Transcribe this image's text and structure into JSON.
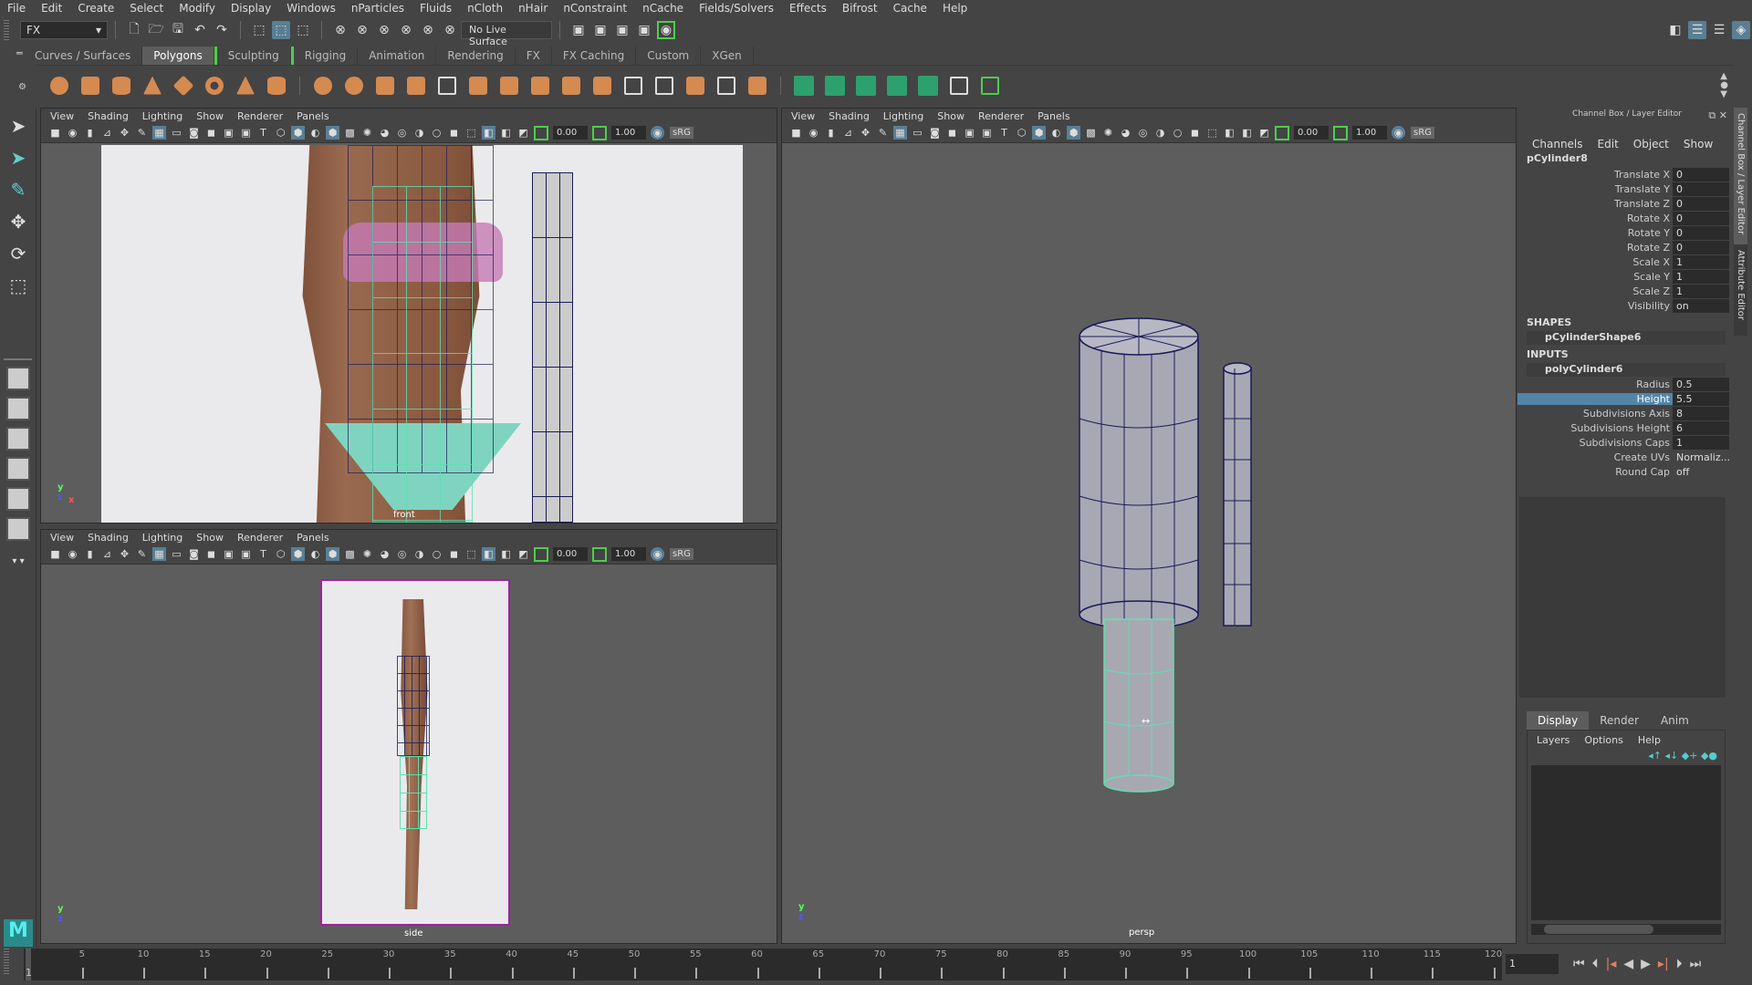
{
  "menubar": [
    "File",
    "Edit",
    "Create",
    "Select",
    "Modify",
    "Display",
    "Windows",
    "nParticles",
    "Fluids",
    "nCloth",
    "nHair",
    "nConstraint",
    "nCache",
    "Fields/Solvers",
    "Effects",
    "Bifrost",
    "Cache",
    "Help"
  ],
  "statusline": {
    "mode": "FX",
    "live_surface": "No Live Surface"
  },
  "shelf_tabs": [
    "Curves / Surfaces",
    "Polygons",
    "Sculpting",
    "Rigging",
    "Animation",
    "Rendering",
    "FX",
    "FX Caching",
    "Custom",
    "XGen"
  ],
  "shelf_selected": "Polygons",
  "panel_menu": [
    "View",
    "Shading",
    "Lighting",
    "Show",
    "Renderer",
    "Panels"
  ],
  "panel_toolbar": {
    "exposure": "0.00",
    "gamma": "1.00",
    "colorspace": "sRG"
  },
  "viewports": {
    "front": "front",
    "side": "side",
    "persp": "persp"
  },
  "axis": {
    "x": "x",
    "y": "y",
    "z": "z"
  },
  "channel_box": {
    "title": "Channel Box / Layer Editor",
    "menu": [
      "Channels",
      "Edit",
      "Object",
      "Show"
    ],
    "object": "pCylinder8",
    "transform": [
      {
        "label": "Translate X",
        "value": "0"
      },
      {
        "label": "Translate Y",
        "value": "0"
      },
      {
        "label": "Translate Z",
        "value": "0"
      },
      {
        "label": "Rotate X",
        "value": "0"
      },
      {
        "label": "Rotate Y",
        "value": "0"
      },
      {
        "label": "Rotate Z",
        "value": "0"
      },
      {
        "label": "Scale X",
        "value": "1"
      },
      {
        "label": "Scale Y",
        "value": "1"
      },
      {
        "label": "Scale Z",
        "value": "1"
      },
      {
        "label": "Visibility",
        "value": "on"
      }
    ],
    "shapes_header": "SHAPES",
    "shape": "pCylinderShape6",
    "inputs_header": "INPUTS",
    "input_node": "polyCylinder6",
    "inputs": [
      {
        "label": "Radius",
        "value": "0.5"
      },
      {
        "label": "Height",
        "value": "5.5",
        "highlighted": true
      },
      {
        "label": "Subdivisions Axis",
        "value": "8"
      },
      {
        "label": "Subdivisions Height",
        "value": "6"
      },
      {
        "label": "Subdivisions Caps",
        "value": "1"
      },
      {
        "label": "Create UVs",
        "value": "Normaliz..."
      },
      {
        "label": "Round Cap",
        "value": "off"
      }
    ]
  },
  "side_tabs": [
    "Channel Box / Layer Editor",
    "Attribute Editor"
  ],
  "layer_editor": {
    "tabs": [
      "Display",
      "Render",
      "Anim"
    ],
    "selected_tab": "Display",
    "menu": [
      "Layers",
      "Options",
      "Help"
    ]
  },
  "timeline": {
    "start": 1,
    "ticks": [
      5,
      10,
      15,
      20,
      25,
      30,
      35,
      40,
      45,
      50,
      55,
      60,
      65,
      70,
      75,
      80,
      85,
      90,
      95,
      100,
      105,
      110,
      115,
      120
    ],
    "current_frame": "1",
    "start_label": "1"
  },
  "colors": {
    "accent": "#5285a6",
    "selection": "#5fe0b0",
    "wire": "#1a1a5a",
    "bracket": "#4dce4d"
  }
}
